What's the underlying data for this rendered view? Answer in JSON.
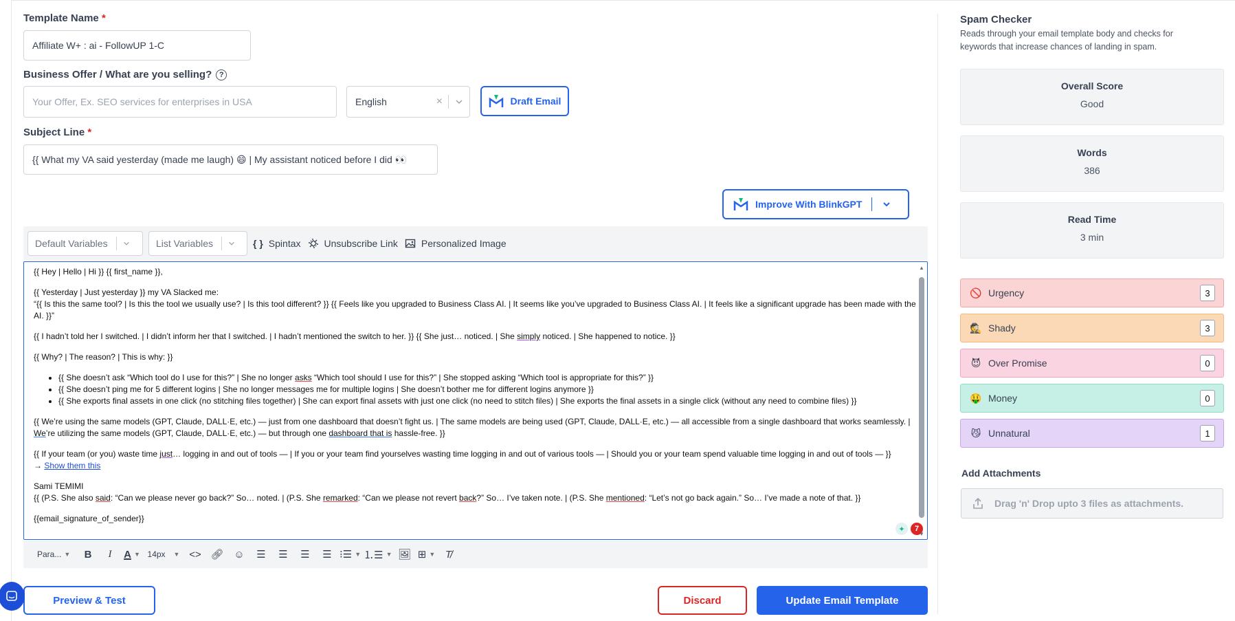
{
  "form": {
    "template_name_label": "Template Name",
    "required_mark": "*",
    "template_name_value": "Affiliate W+ : ai - FollowUP 1-C",
    "business_offer_label": "Business Offer / What are you selling?",
    "help_icon": "?",
    "business_offer_placeholder": "Your Offer, Ex. SEO services for enterprises in USA",
    "language_value": "English",
    "clear_icon": "×",
    "draft_email_label": "Draft Email",
    "subject_label": "Subject Line",
    "subject_value": "{{ What my VA said yesterday (made me laugh) 😄 | My assistant noticed before I did 👀",
    "improve_label": "Improve With BlinkGPT"
  },
  "toolbar": {
    "default_variables": "Default Variables",
    "list_variables": "List Variables",
    "spintax_glyph": "{ }",
    "spintax": "Spintax",
    "unsubscribe": "Unsubscribe Link",
    "personalized_image": "Personalized Image"
  },
  "editor": {
    "p1": "{{ Hey | Hello | Hi }} {{ first_name }},",
    "p2a": "{{ Yesterday | Just yesterday }} my VA Slacked me:",
    "p2b": "“{{ Is this the same tool? | Is this the tool we usually use? | Is this tool different? }} {{ Feels like you upgraded to Business Class AI. | It seems like you’ve upgraded to Business Class AI. | It feels like a significant upgrade has been made with the AI. }}”",
    "p3a": "{{ I hadn’t told her I switched. | I didn’t inform her that I switched. | I hadn’t mentioned the switch to her. }} {{ She just… noticed. | She ",
    "p3u": "simply",
    "p3b": " noticed. | She happened to notice. }}",
    "p4": "{{ Why? | The reason? | This is why: }}",
    "li1a": "{{ She doesn’t ask “Which tool do I use for this?” | She no longer ",
    "li1u": "asks",
    "li1b": " “Which tool should I use for this?” | She stopped asking “Which tool is appropriate for this?” }}",
    "li2": "{{ She doesn’t ping me for 5 different logins | She no longer messages me for multiple logins | She doesn’t bother me for different logins anymore }}",
    "li3": "{{ She exports final assets in one click (no stitching files together) | She can export final assets with just one click (no need to stitch files) | She exports the final assets in a single click (without any need to combine files) }}",
    "p5a": "{{ We’re using the same models (GPT, Claude, DALL·E, etc.) — just from one dashboard that doesn’t fight us. | The same models are being used (GPT, Claude, DALL·E, etc.) — all accessible from a single dashboard that works seamlessly. ",
    "p5u1": "| We",
    "p5b": "’re utilizing the same models (GPT, Claude, DALL·E, etc.) — but through one ",
    "p5u2": "dashboard that is",
    "p5c": " hassle-free. }}",
    "p6a": "{{ If your team (or you) waste time ",
    "p6u": "just",
    "p6b": "… logging in and out of tools — | If you or your team find yourselves wasting time logging in and out of various tools — | Should you or your team spend valuable time logging in and out of tools — }}",
    "arrow": "→ ",
    "show_link": "Show them this",
    "signature_name": "Sami TEMIMI",
    "ps_a": "{{ (P.S. She also ",
    "ps_u1": "said",
    "ps_b": ": “Can we please never go back?” So… noted. | (P.S. She ",
    "ps_u2": "remarked",
    "ps_c": ": “Can we please not revert ",
    "ps_u3": "back",
    "ps_d": "?” So… I’ve taken note. | (P.S. She ",
    "ps_u4": "mentioned",
    "ps_e": ": “Let’s not go back again.” So… I’ve made a note of that. }}",
    "signature_var": "{{email_signature_of_sender}}",
    "grammar_count": "7"
  },
  "format_bar": {
    "paragraph": "Para...",
    "font_size": "14px"
  },
  "actions": {
    "preview_test": "Preview & Test",
    "discard": "Discard",
    "update": "Update Email Template"
  },
  "spam": {
    "title": "Spam Checker",
    "description": "Reads through your email template body and checks for keywords that increase chances of landing in spam.",
    "overall_label": "Overall Score",
    "overall_value": "Good",
    "words_label": "Words",
    "words_value": "386",
    "read_label": "Read Time",
    "read_value": "3 min",
    "categories": [
      {
        "name": "Urgency",
        "count": "3",
        "icon": "🚫"
      },
      {
        "name": "Shady",
        "count": "3",
        "icon": "🕵"
      },
      {
        "name": "Over Promise",
        "count": "0",
        "icon": "😈"
      },
      {
        "name": "Money",
        "count": "0",
        "icon": "🤑"
      },
      {
        "name": "Unnatural",
        "count": "1",
        "icon": "😼"
      }
    ],
    "attachments_title": "Add Attachments",
    "dropzone_text": "Drag 'n' Drop upto 3 files as attachments."
  },
  "colors": {
    "accent": "#2563eb",
    "urgency_bg": "#fbd5d5",
    "shady_bg": "#fcd9b6",
    "overpromise_bg": "#fbd4e1",
    "money_bg": "#c6f0e6",
    "unnatural_bg": "#e3d4f8"
  }
}
